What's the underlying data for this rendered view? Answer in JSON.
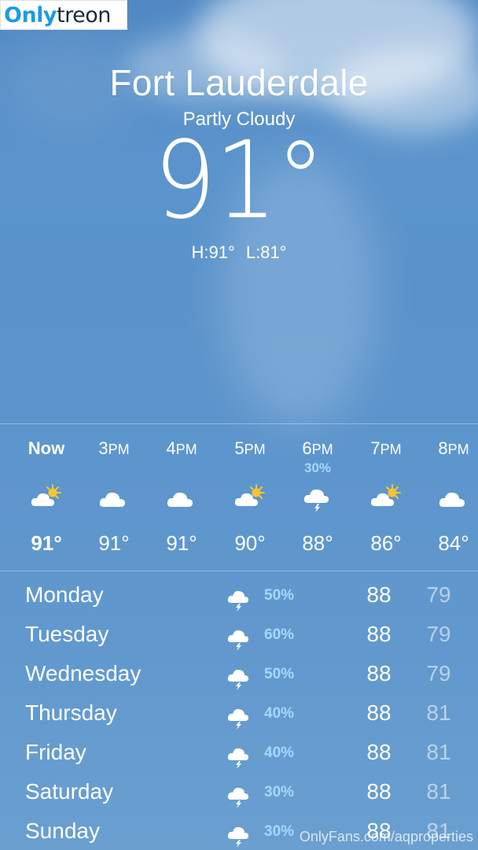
{
  "watermark": {
    "brand_a": "Only",
    "brand_b": "treon",
    "footer": "OnlyFans.com/aqproperties"
  },
  "location": {
    "city": "Fort Lauderdale",
    "condition": "Partly Cloudy",
    "temperature": "91°",
    "high": "H:91°",
    "low": "L:81°"
  },
  "hourly": [
    {
      "time": "Now",
      "ampm": "",
      "pop": "",
      "icon": "sun-behind-cloud-icon",
      "temp": "91°"
    },
    {
      "time": "3",
      "ampm": "PM",
      "pop": "",
      "icon": "cloud-icon",
      "temp": "91°"
    },
    {
      "time": "4",
      "ampm": "PM",
      "pop": "",
      "icon": "cloud-icon",
      "temp": "91°"
    },
    {
      "time": "5",
      "ampm": "PM",
      "pop": "",
      "icon": "sun-behind-cloud-icon",
      "temp": "90°"
    },
    {
      "time": "6",
      "ampm": "PM",
      "pop": "30%",
      "icon": "thunderstorm-icon",
      "temp": "88°"
    },
    {
      "time": "7",
      "ampm": "PM",
      "pop": "",
      "icon": "sun-behind-cloud-icon",
      "temp": "86°"
    },
    {
      "time": "8",
      "ampm": "PM",
      "pop": "",
      "icon": "cloud-icon",
      "temp": "84°"
    }
  ],
  "daily": [
    {
      "day": "Monday",
      "icon": "thunderstorm-icon",
      "pop": "50%",
      "high": "88",
      "low": "79"
    },
    {
      "day": "Tuesday",
      "icon": "thunderstorm-icon",
      "pop": "60%",
      "high": "88",
      "low": "79"
    },
    {
      "day": "Wednesday",
      "icon": "thunderstorm-icon",
      "pop": "50%",
      "high": "88",
      "low": "79"
    },
    {
      "day": "Thursday",
      "icon": "thunderstorm-icon",
      "pop": "40%",
      "high": "88",
      "low": "81"
    },
    {
      "day": "Friday",
      "icon": "thunderstorm-icon",
      "pop": "40%",
      "high": "88",
      "low": "81"
    },
    {
      "day": "Saturday",
      "icon": "thunderstorm-icon",
      "pop": "30%",
      "high": "88",
      "low": "81"
    },
    {
      "day": "Sunday",
      "icon": "thunderstorm-icon",
      "pop": "30%",
      "high": "88",
      "low": "81"
    }
  ],
  "colors": {
    "sky_top": "#4f88c3",
    "sky_bottom": "#6a9fd0",
    "precip_accent": "#a6d8ff",
    "sun": "#f7c531"
  }
}
